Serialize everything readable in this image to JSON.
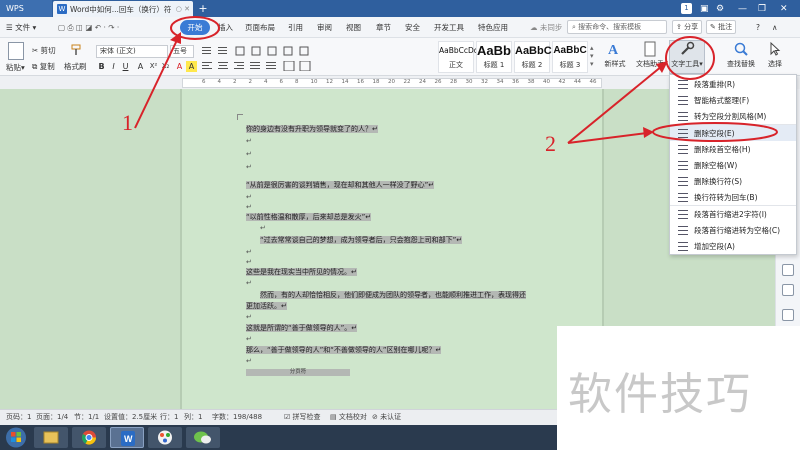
{
  "titlebar": {
    "app_name": "WPS",
    "doc_tab_title": "Word中如何...回车（换行）符",
    "doc_tab_icon": "W",
    "doc_tab_controls": "○ ✕",
    "new_tab": "+",
    "badge": "1"
  },
  "menubar": {
    "file_menu": "文件",
    "start_tab": "开始",
    "tabs": [
      "插入",
      "页面布局",
      "引用",
      "审阅",
      "视图",
      "章节",
      "安全",
      "开发工具",
      "特色应用"
    ],
    "cloud_status": "未同步",
    "search_placeholder": "搜索命令、搜索模板",
    "share": "分享",
    "comment": "批注",
    "help": "?",
    "collapse": "∧"
  },
  "ribbon": {
    "paste": "粘贴",
    "cut": "剪切",
    "copy": "复制",
    "format_painter": "格式刷",
    "font_name": "宋体 (正文)",
    "font_size": "五号",
    "format_buttons": [
      "B",
      "I",
      "U",
      "A",
      "X²",
      "X₂",
      "A",
      "A"
    ],
    "styles": [
      {
        "preview": "AaBbCcDd",
        "name": "正文"
      },
      {
        "preview": "AaBb",
        "name": "标题 1"
      },
      {
        "preview": "AaBbC",
        "name": "标题 2"
      },
      {
        "preview": "AaBbC",
        "name": "标题 3"
      }
    ],
    "new_style": "新样式",
    "text_assistant": "文档助手",
    "text_tools": "文字工具",
    "find_replace": "查找替换",
    "select": "选择"
  },
  "ruler": {
    "ticks": [
      "6",
      "4",
      "2",
      "2",
      "4",
      "6",
      "8",
      "10",
      "12",
      "14",
      "16",
      "18",
      "20",
      "22",
      "24",
      "26",
      "28",
      "30",
      "32",
      "34",
      "36",
      "38",
      "40",
      "42",
      "44",
      "46"
    ]
  },
  "document": {
    "lines": [
      "你的身边有没有升职为领导就变了的人？↵",
      "↵",
      "↵",
      "↵",
      "“从前是很厉害的谈判销售，现在却和其他人一样没了野心”↵",
      "↵",
      "↵",
      "“以前性格温和散厚，后来却总是发火”↵",
      "↵",
      "“过去常常谈自己的梦想，成为领导者后，只会抱怨上司和部下”↵",
      "↵",
      "↵",
      "这些是我在现实当中所见的情况。↵",
      "↵",
      "然而，有的人却恰恰相反，他们即便成为团队的领导者，也能顺利推进工作，表现得还",
      "更加活跃。↵",
      "↵",
      "这就是所谓的“善于做领导的人”。↵",
      "↵",
      "那么，“善于做领导的人”和“不善做领导的人”区别在哪儿呢？↵",
      "↵",
      "分页符"
    ]
  },
  "dropdown": {
    "items": [
      "段落重排(R)",
      "智能格式整理(F)",
      "转为空段分割风格(M)",
      "删除空段(E)",
      "删除段首空格(H)",
      "删除空格(W)",
      "删除换行符(S)",
      "换行符转为回车(B)",
      "段落首行缩进2字符(I)",
      "段落首行缩进转为空格(C)",
      "增加空段(A)"
    ]
  },
  "statusbar": {
    "page_no": "页码：1",
    "pages": "页面：1/4",
    "section": "节：1/1",
    "setting": "设置值：2.5厘米",
    "row": "行：1",
    "col": "列：1",
    "words": "字数：198/488",
    "spell": "拼写检查",
    "doc_check": "文档校对",
    "auth": "未认证"
  },
  "annotations": {
    "label_1": "1",
    "label_2": "2",
    "color": "#d8232a"
  },
  "watermark": {
    "text": "软件技巧"
  }
}
